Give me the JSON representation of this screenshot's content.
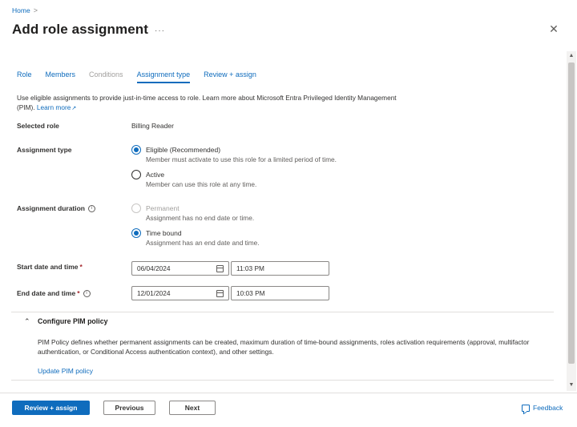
{
  "breadcrumb": {
    "home": "Home",
    "separator": ">"
  },
  "header": {
    "title": "Add role assignment",
    "more": "···",
    "close": "✕"
  },
  "tabs": [
    {
      "label": "Role",
      "state": "enabled"
    },
    {
      "label": "Members",
      "state": "enabled"
    },
    {
      "label": "Conditions",
      "state": "disabled"
    },
    {
      "label": "Assignment type",
      "state": "active"
    },
    {
      "label": "Review + assign",
      "state": "enabled"
    }
  ],
  "intro": {
    "text": "Use eligible assignments to provide just-in-time access to role. Learn more about Microsoft Entra Privileged Identity Management (PIM).",
    "link": "Learn more"
  },
  "selected_role": {
    "label": "Selected role",
    "value": "Billing Reader"
  },
  "assignment_type": {
    "label": "Assignment type",
    "options": [
      {
        "label": "Eligible (Recommended)",
        "desc": "Member must activate to use this role for a limited period of time.",
        "checked": true
      },
      {
        "label": "Active",
        "desc": "Member can use this role at any time.",
        "checked": false
      }
    ]
  },
  "assignment_duration": {
    "label": "Assignment duration",
    "info": "i",
    "options": [
      {
        "label": "Permanent",
        "desc": "Assignment has no end date or time.",
        "checked": false,
        "disabled": true
      },
      {
        "label": "Time bound",
        "desc": "Assignment has an end date and time.",
        "checked": true,
        "disabled": false
      }
    ]
  },
  "start": {
    "label": "Start date and time",
    "required": "*",
    "date": "06/04/2024",
    "time": "11:03 PM"
  },
  "end": {
    "label": "End date and time",
    "required": "*",
    "info": "i",
    "date": "12/01/2024",
    "time": "10:03 PM"
  },
  "pim": {
    "toggle": "⌃",
    "title": "Configure PIM policy",
    "description": "PIM Policy defines whether permanent assignments can be created, maximum duration of time-bound assignments, roles activation requirements (approval, multifactor authentication, or Conditional Access authentication context), and other settings.",
    "link": "Update PIM policy"
  },
  "footer": {
    "review_assign": "Review + assign",
    "previous": "Previous",
    "next": "Next",
    "feedback": "Feedback"
  },
  "colors": {
    "accent": "#0f6cbd",
    "text": "#323130",
    "muted": "#605e5c",
    "disabled": "#a19f9d",
    "required": "#a4262c"
  },
  "icons": {
    "more": "more-icon",
    "close": "close-icon",
    "external": "external-link-icon",
    "info": "info-icon",
    "calendar": "calendar-icon",
    "chevron": "chevron-up-icon",
    "feedback": "feedback-icon"
  }
}
